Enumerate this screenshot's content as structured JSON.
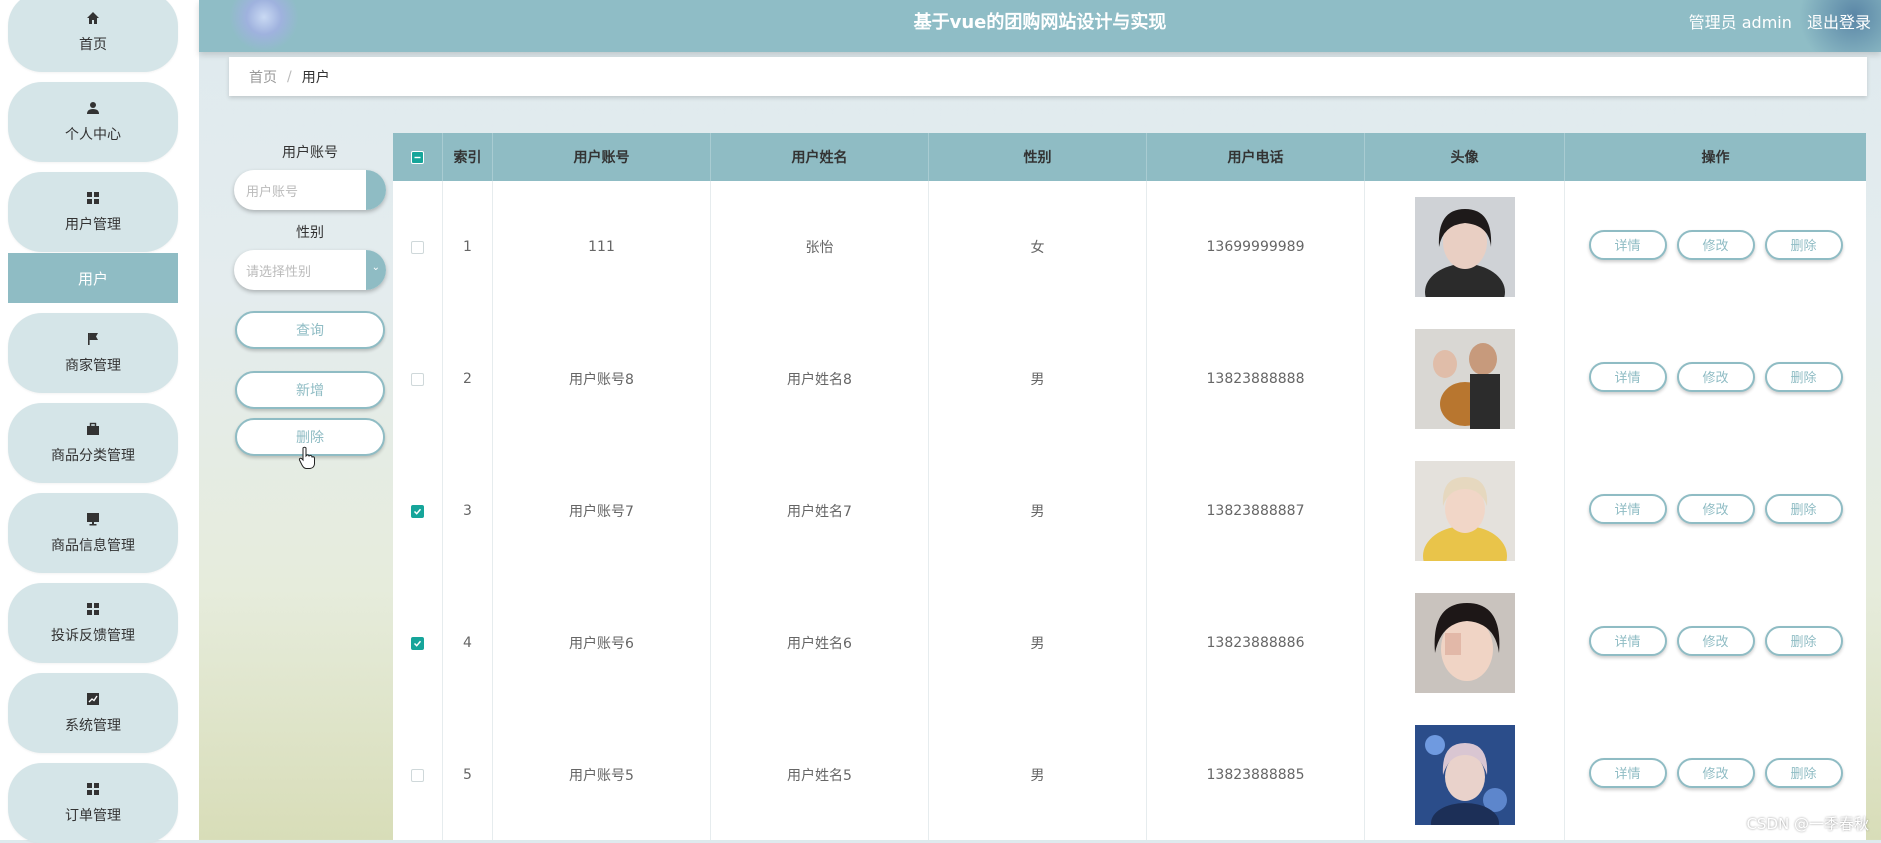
{
  "header": {
    "title": "基于vue的团购网站设计与实现",
    "admin_label": "管理员 admin",
    "logout_label": "退出登录"
  },
  "sidebar": {
    "items": [
      {
        "label": "首页",
        "icon": "home-icon"
      },
      {
        "label": "个人中心",
        "icon": "user-icon"
      },
      {
        "label": "用户管理",
        "icon": "grid-icon"
      },
      {
        "label": "商家管理",
        "icon": "flag-icon"
      },
      {
        "label": "商品分类管理",
        "icon": "briefcase-icon"
      },
      {
        "label": "商品信息管理",
        "icon": "monitor-icon"
      },
      {
        "label": "投诉反馈管理",
        "icon": "grid-icon"
      },
      {
        "label": "系统管理",
        "icon": "chart-icon"
      },
      {
        "label": "订单管理",
        "icon": "grid-icon"
      }
    ],
    "sub_item": "用户"
  },
  "breadcrumb": {
    "home": "首页",
    "sep": "/",
    "current": "用户"
  },
  "search": {
    "account_label": "用户账号",
    "account_placeholder": "用户账号",
    "gender_label": "性别",
    "gender_placeholder": "请选择性别",
    "query_btn": "查询",
    "add_btn": "新增",
    "delete_btn": "删除"
  },
  "table": {
    "headers": [
      "索引",
      "用户账号",
      "用户姓名",
      "性别",
      "用户电话",
      "头像",
      "操作"
    ],
    "op_labels": {
      "detail": "详情",
      "edit": "修改",
      "delete": "删除"
    },
    "rows": [
      {
        "index": "1",
        "account": "111",
        "name": "张怡",
        "gender": "女",
        "phone": "13699999989",
        "checked": false
      },
      {
        "index": "2",
        "account": "用户账号8",
        "name": "用户姓名8",
        "gender": "男",
        "phone": "13823888888",
        "checked": false
      },
      {
        "index": "3",
        "account": "用户账号7",
        "name": "用户姓名7",
        "gender": "男",
        "phone": "13823888887",
        "checked": true
      },
      {
        "index": "4",
        "account": "用户账号6",
        "name": "用户姓名6",
        "gender": "男",
        "phone": "13823888886",
        "checked": true
      },
      {
        "index": "5",
        "account": "用户账号5",
        "name": "用户姓名5",
        "gender": "男",
        "phone": "13823888885",
        "checked": false
      }
    ]
  },
  "watermark": "CSDN @一季春秋",
  "colors": {
    "accent": "#8fbcc4",
    "check": "#16a59a"
  }
}
